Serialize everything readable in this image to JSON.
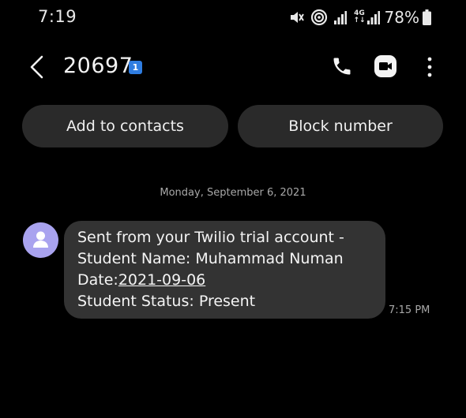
{
  "status_bar": {
    "time": "7:19",
    "network_label_top": "4G",
    "network_label_bottom": "↑↓",
    "battery_percent": "78%",
    "icons": [
      "mute-icon",
      "hotspot-icon",
      "signal-icon",
      "signal-icon",
      "battery-icon"
    ]
  },
  "app_bar": {
    "title": "20697",
    "sim_badge": "1",
    "icons": [
      "back-icon",
      "phone-icon",
      "video-call-icon",
      "more-vertical-icon"
    ]
  },
  "actions": {
    "add_to_contacts": "Add to contacts",
    "block_number": "Block number"
  },
  "conversation": {
    "date": "Monday, September 6, 2021",
    "messages": [
      {
        "line1": "Sent from your Twilio trial account -",
        "line2": "Student Name: Muhammad Numan",
        "line3_prefix": "Date:",
        "line3_link": "2021-09-06",
        "line4": "Student Status: Present",
        "time": "7:15 PM"
      }
    ]
  },
  "colors": {
    "background": "#000000",
    "button_bg": "#2a2a2a",
    "bubble_bg": "#333333",
    "avatar_bg": "#a9a3ef",
    "sim_badge_bg": "#2f7de1",
    "muted_text": "#a8a8a8"
  }
}
